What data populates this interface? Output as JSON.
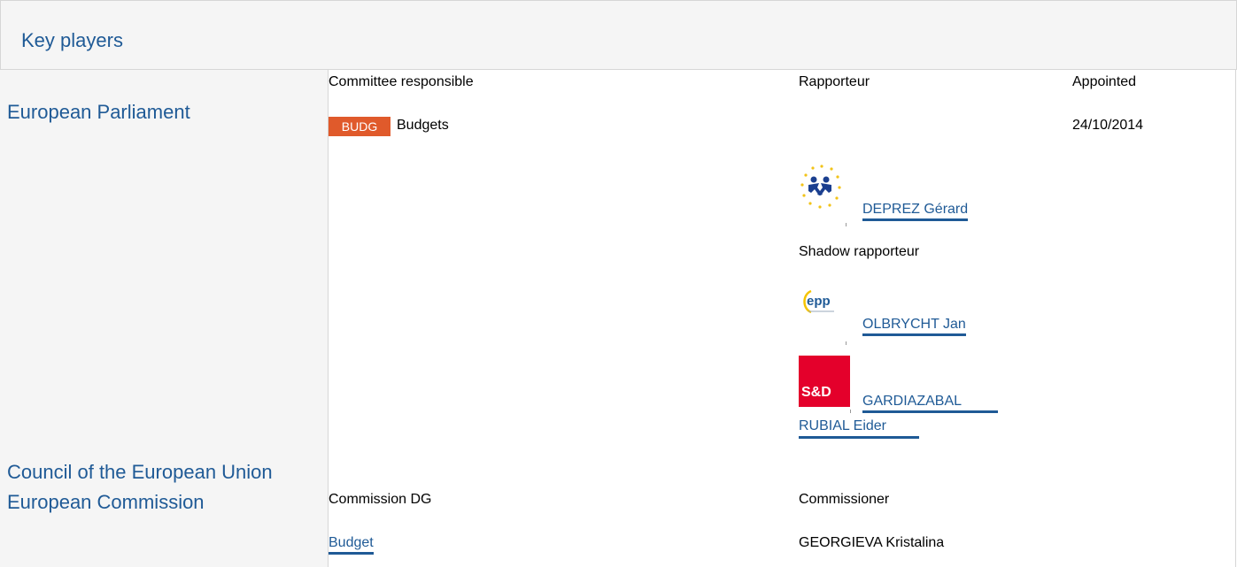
{
  "section": {
    "title": "Key players"
  },
  "institutions": {
    "parliament": "European Parliament",
    "council": "Council of the European Union",
    "commission": "European Commission"
  },
  "parliament": {
    "committee_header": "Committee responsible",
    "rapporteur_header": "Rapporteur",
    "appointed_header": "Appointed",
    "committee": {
      "code": "BUDG",
      "name": "Budgets",
      "badge_color": "#e05a2b"
    },
    "appointed_date": "24/10/2014",
    "rapporteurs": [
      {
        "name": "DEPREZ Gérard",
        "group_logo": "alde-logo-icon"
      }
    ],
    "shadow_header": "Shadow rapporteur",
    "shadow_rapporteurs": [
      {
        "name": "OLBRYCHT Jan",
        "group_logo": "epp-logo-icon",
        "logo_text": "epp"
      },
      {
        "name_line1": "GARDIAZABAL",
        "name_line2": "RUBIAL Eider",
        "group_logo": "sd-logo-icon",
        "logo_text": "S&D"
      }
    ]
  },
  "commission": {
    "dg_header": "Commission DG",
    "commissioner_header": "Commissioner",
    "dg": "Budget",
    "commissioner": "GEORGIEVA Kristalina"
  },
  "colors": {
    "link": "#1f5a96",
    "panel_bg": "#f5f5f5",
    "border": "#d6d6d6"
  }
}
